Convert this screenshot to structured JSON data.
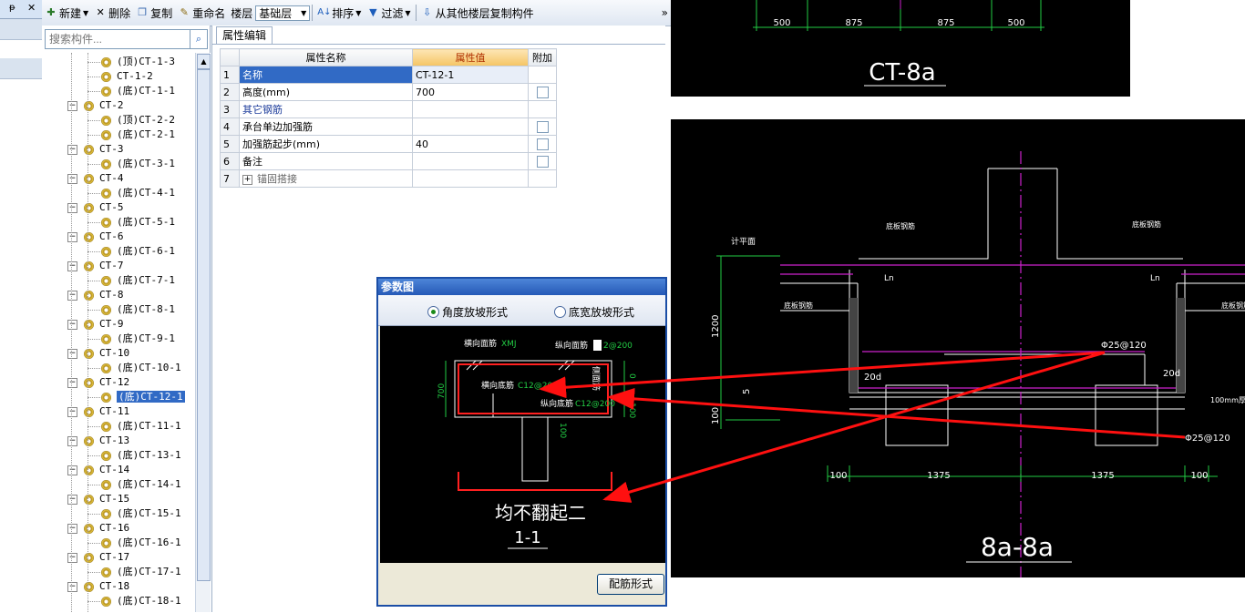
{
  "left_strip": {
    "pin": "ᵽ",
    "close": "✕"
  },
  "toolbar": {
    "new": "新建",
    "delete": "删除",
    "copy": "复制",
    "rename": "重命名",
    "floor_label": "楼层",
    "floor_value": "基础层",
    "sort": "排序",
    "filter": "过滤",
    "copy_from": "从其他楼层复制构件",
    "more": "»"
  },
  "search": {
    "placeholder": "搜索构件..."
  },
  "tree": {
    "items": [
      {
        "level": 2,
        "text": "(顶)CT-1-3"
      },
      {
        "level": 2,
        "text": "CT-1-2"
      },
      {
        "level": 2,
        "text": "(底)CT-1-1"
      },
      {
        "level": 1,
        "text": "CT-2"
      },
      {
        "level": 2,
        "text": "(顶)CT-2-2"
      },
      {
        "level": 2,
        "text": "(底)CT-2-1"
      },
      {
        "level": 1,
        "text": "CT-3"
      },
      {
        "level": 2,
        "text": "(底)CT-3-1"
      },
      {
        "level": 1,
        "text": "CT-4"
      },
      {
        "level": 2,
        "text": "(底)CT-4-1"
      },
      {
        "level": 1,
        "text": "CT-5"
      },
      {
        "level": 2,
        "text": "(底)CT-5-1"
      },
      {
        "level": 1,
        "text": "CT-6"
      },
      {
        "level": 2,
        "text": "(底)CT-6-1"
      },
      {
        "level": 1,
        "text": "CT-7"
      },
      {
        "level": 2,
        "text": "(底)CT-7-1"
      },
      {
        "level": 1,
        "text": "CT-8"
      },
      {
        "level": 2,
        "text": "(底)CT-8-1"
      },
      {
        "level": 1,
        "text": "CT-9"
      },
      {
        "level": 2,
        "text": "(底)CT-9-1"
      },
      {
        "level": 1,
        "text": "CT-10"
      },
      {
        "level": 2,
        "text": "(底)CT-10-1"
      },
      {
        "level": 1,
        "text": "CT-12"
      },
      {
        "level": 2,
        "text": "(底)CT-12-1",
        "selected": true
      },
      {
        "level": 1,
        "text": "CT-11"
      },
      {
        "level": 2,
        "text": "(底)CT-11-1"
      },
      {
        "level": 1,
        "text": "CT-13"
      },
      {
        "level": 2,
        "text": "(底)CT-13-1"
      },
      {
        "level": 1,
        "text": "CT-14"
      },
      {
        "level": 2,
        "text": "(底)CT-14-1"
      },
      {
        "level": 1,
        "text": "CT-15"
      },
      {
        "level": 2,
        "text": "(底)CT-15-1"
      },
      {
        "level": 1,
        "text": "CT-16"
      },
      {
        "level": 2,
        "text": "(底)CT-16-1"
      },
      {
        "level": 1,
        "text": "CT-17"
      },
      {
        "level": 2,
        "text": "(底)CT-17-1"
      },
      {
        "level": 1,
        "text": "CT-18"
      },
      {
        "level": 2,
        "text": "(底)CT-18-1"
      }
    ]
  },
  "props": {
    "tab": "属性编辑",
    "col_name": "属性名称",
    "col_value": "属性值",
    "col_add": "附加",
    "rows": [
      {
        "num": "1",
        "name": "名称",
        "value": "CT-12-1",
        "checkbox": false
      },
      {
        "num": "2",
        "name": "高度(mm)",
        "value": "700",
        "checkbox": true
      },
      {
        "num": "3",
        "name": "其它钢筋",
        "value": "",
        "checkbox": false
      },
      {
        "num": "4",
        "name": "承台单边加强筋",
        "value": "",
        "checkbox": true
      },
      {
        "num": "5",
        "name": "加强筋起步(mm)",
        "value": "40",
        "checkbox": true
      },
      {
        "num": "6",
        "name": "备注",
        "value": "",
        "checkbox": true
      },
      {
        "num": "7",
        "name": "锚固搭接",
        "value": "",
        "checkbox": false
      }
    ]
  },
  "dialog": {
    "title": "参数图",
    "radio1": "角度放坡形式",
    "radio2": "底宽放坡形式",
    "button": "配筋形式",
    "diagram": {
      "top_h": "横向面筋",
      "top_h_val": "XMJ",
      "top_v": "纵向面筋",
      "top_v_val": "2@200",
      "bottom_h": "横向底筋",
      "bottom_h_val": "C12@200",
      "bottom_v": "纵向底筋",
      "bottom_v_val": "C12@200",
      "side": "侧面筋",
      "dim_700": "700",
      "dim_0": "0",
      "dim_100a": "100",
      "dim_100b": "100",
      "note": "均不翻起二",
      "section": "1-1"
    }
  },
  "cad_top": {
    "dims": [
      "500",
      "875",
      "875",
      "500"
    ],
    "label": "CT-8a"
  },
  "cad_main": {
    "label": "8a-8a",
    "dims_bottom": [
      "100",
      "1375",
      "1375",
      "100"
    ],
    "dim_1200": "1200",
    "dim_100": "100",
    "dim_5": "5",
    "ln_left": "Ln",
    "ln_right": "Ln",
    "d20_left": "20d",
    "d20_right": "20d",
    "rebar_top": "Φ25@120",
    "rebar_bottom": "Φ25@120",
    "level_mark": "计平面",
    "note_left": "底板钢筋",
    "note_right": "底板钢筋",
    "note_top_left": "底板钢筋",
    "note_top_right": "底板钢筋",
    "note_cushion": "100mm厚"
  },
  "colors": {
    "arrow": "#ff1010",
    "cad_green": "#22cc44",
    "cad_magenta": "#cc22cc",
    "selection": "#316ac5"
  }
}
